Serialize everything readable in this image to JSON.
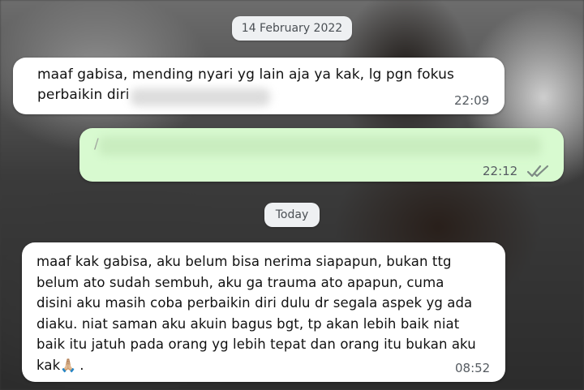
{
  "chat": {
    "date_separator_1": "14 February 2022",
    "date_separator_2": "Today",
    "messages": [
      {
        "direction": "incoming",
        "text": "maaf gabisa, mending nyari yg lain aja ya kak, lg pgn fokus\nperbaikin diri",
        "time": "22:09",
        "redacted": true
      },
      {
        "direction": "outgoing",
        "text": "/",
        "time": "22:12",
        "status_icon": "double-check-icon",
        "redacted": true
      },
      {
        "direction": "incoming",
        "text": "maaf kak gabisa, aku belum bisa nerima siapapun, bukan ttg\nbelum ato sudah sembuh, aku ga trauma ato apapun, cuma\ndisini aku masih coba perbaikin diri dulu dr segala aspek yg ada\ndiaku. niat saman aku akuin bagus bgt, tp akan lebih baik niat\nbaik itu jatuh pada orang yg lebih tepat dan orang itu bukan aku\nkak",
        "emoji": "🙏🏼",
        "trailing": ".",
        "time": "08:52"
      }
    ]
  },
  "colors": {
    "incoming_bubble": "#ffffff",
    "outgoing_bubble": "#d8fad0",
    "date_chip": "#eef0f2",
    "timestamp": "#555b61",
    "read_tick": "#7d8a84"
  }
}
